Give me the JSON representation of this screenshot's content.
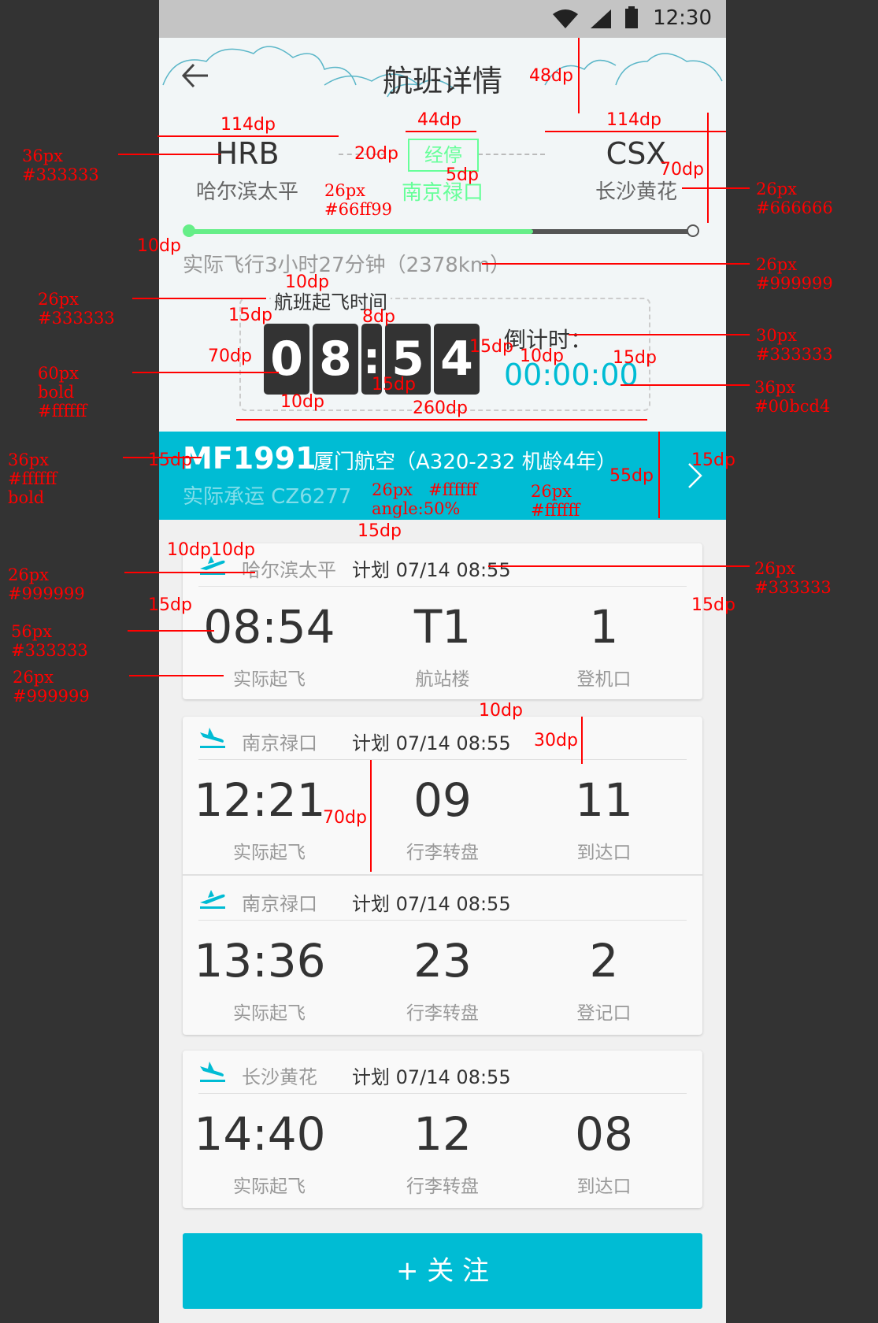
{
  "status_bar": {
    "time": "12:30"
  },
  "header": {
    "title": "航班详情",
    "back_icon": "arrow-left-icon"
  },
  "route": {
    "origin": {
      "code": "HRB",
      "name": "哈尔滨太平"
    },
    "stopover": {
      "badge": "经停",
      "name": "南京禄口"
    },
    "destination": {
      "code": "CSX",
      "name": "长沙黄花"
    },
    "progress": 0.68,
    "summary": "实际飞行3小时27分钟（2378km）"
  },
  "departure_time": {
    "label": "航班起飞时间",
    "digits": [
      "0",
      "8",
      "5",
      "4"
    ],
    "colon": ":",
    "countdown_label": "倒计时：",
    "countdown_value": "00:00:00"
  },
  "flight": {
    "number": "MF1991",
    "airline": "厦门航空（A320-232 机龄4年）",
    "operated_by": "实际承运 CZ6277",
    "chevron_icon": "chevron-right-icon"
  },
  "segments": [
    {
      "city": "哈尔滨太平",
      "plan": "计划 07/14 08:55",
      "icon": "plane-departure-icon",
      "time": "08:54",
      "time_label": "实际起飞",
      "mid": "T1",
      "mid_label": "航站楼",
      "right": "1",
      "right_label": "登机口"
    },
    {
      "city": "南京禄口",
      "plan": "计划 07/14 08:55",
      "icon": "plane-arrival-icon",
      "time": "12:21",
      "time_label": "实际起飞",
      "mid": "09",
      "mid_label": "行李转盘",
      "right": "11",
      "right_label": "到达口"
    },
    {
      "city": "南京禄口",
      "plan": "计划 07/14 08:55",
      "icon": "plane-departure-icon",
      "time": "13:36",
      "time_label": "实际起飞",
      "mid": "23",
      "mid_label": "行李转盘",
      "right": "2",
      "right_label": "登记口"
    },
    {
      "city": "长沙黄花",
      "plan": "计划 07/14 08:55",
      "icon": "plane-arrival-icon",
      "time": "14:40",
      "time_label": "实际起飞",
      "mid": "12",
      "mid_label": "行李转盘",
      "right": "08",
      "right_label": "到达口"
    }
  ],
  "follow_button": {
    "label": "+ 关 注"
  },
  "colors": {
    "accent": "#00bcd4",
    "green": "#66ff99",
    "dark": "#333333",
    "mid": "#666666",
    "light": "#999999"
  },
  "annotations": {
    "a_48dp": "48dp",
    "a_114dp": "114dp",
    "a_44dp": "44dp",
    "a_20dp": "20dp",
    "a_5dp": "5dp",
    "a_70dp": "70dp",
    "a_10dp": "10dp",
    "a_8dp": "8dp",
    "a_15dp": "15dp",
    "a_260dp": "260dp",
    "a_55dp": "55dp",
    "a_30dp": "30dp",
    "a_36px": "36px",
    "a_26px": "26px",
    "a_30px": "30px",
    "a_60px": "60px",
    "a_56px": "56px",
    "c_333333": "#333333",
    "c_666666": "#666666",
    "c_999999": "#999999",
    "c_66ff99": "#66ff99",
    "c_ffffff": "#ffffff",
    "c_00bcd4": "#00bcd4",
    "w_bold": "bold",
    "w_angle": "angle:50%"
  }
}
